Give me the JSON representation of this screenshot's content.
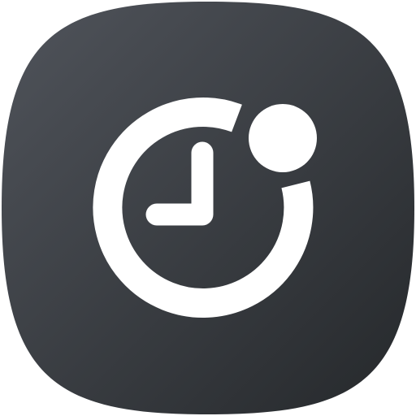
{
  "app_icon": {
    "name": "clock-with-notification-dot",
    "glyph_icon": "clock-icon",
    "badge_icon": "notification-dot-icon",
    "colors": {
      "background_top_left": "#50545b",
      "background_bottom_right": "#25282b",
      "glyph": "#ffffff"
    }
  }
}
